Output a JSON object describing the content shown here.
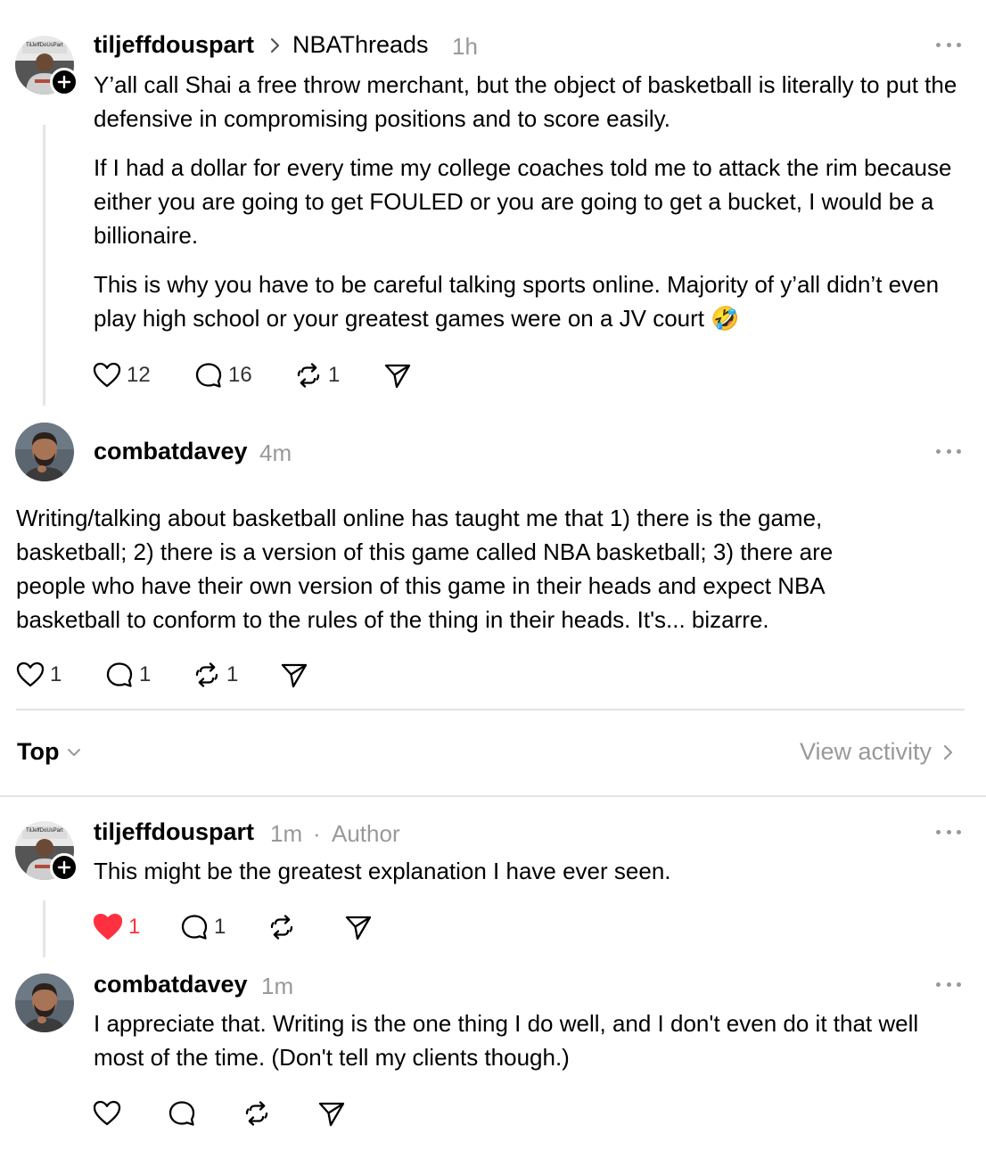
{
  "post1": {
    "username": "tiljeffdouspart",
    "crumb_sep_icon": "chevron-right-icon",
    "community": "NBAThreads",
    "time": "1h",
    "avatar_shirt_text": "TilJeffDoUsPart",
    "paragraphs": [
      "Y’all call Shai a free throw merchant, but the object of basketball is literally to put the defensive in compromising positions and to score easily.",
      "If I had a dollar for every time my college coaches told me to attack the rim because either you are going to get FOULED or you are going to get a bucket, I would be a billionaire.",
      "This is why you have to be careful talking sports online. Majority of y’all didn’t even play high school or your greatest games were on a JV court 🤣"
    ],
    "likes": "12",
    "replies": "16",
    "reposts": "1"
  },
  "post2": {
    "username": "combatdavey",
    "time": "4m",
    "text": "Writing/talking about basketball online has taught me that 1) there is the game, basketball; 2) there is a version of this game called NBA basketball; 3) there are people who have their own version of this game in their heads and expect NBA basketball to conform to the rules of the thing in their heads. It's... bizarre.",
    "likes": "1",
    "replies": "1",
    "reposts": "1"
  },
  "sort_bar": {
    "sort_label": "Top",
    "view_activity": "View activity"
  },
  "reply1": {
    "username": "tiljeffdouspart",
    "time": "1m",
    "separator": "·",
    "badge": "Author",
    "avatar_shirt_text": "TilJeffDoUsPart",
    "text": "This might be the greatest explanation I have ever seen.",
    "likes": "1",
    "replies": "1",
    "liked": true
  },
  "reply2": {
    "username": "combatdavey",
    "time": "1m",
    "text": "I appreciate that. Writing is the one thing I do well, and I don't even do it that well most of the time. (Don't tell my clients though.)"
  },
  "colors": {
    "text": "#000000",
    "muted": "#999999",
    "like_red": "#ff3040",
    "divider": "#e3e3e3"
  }
}
